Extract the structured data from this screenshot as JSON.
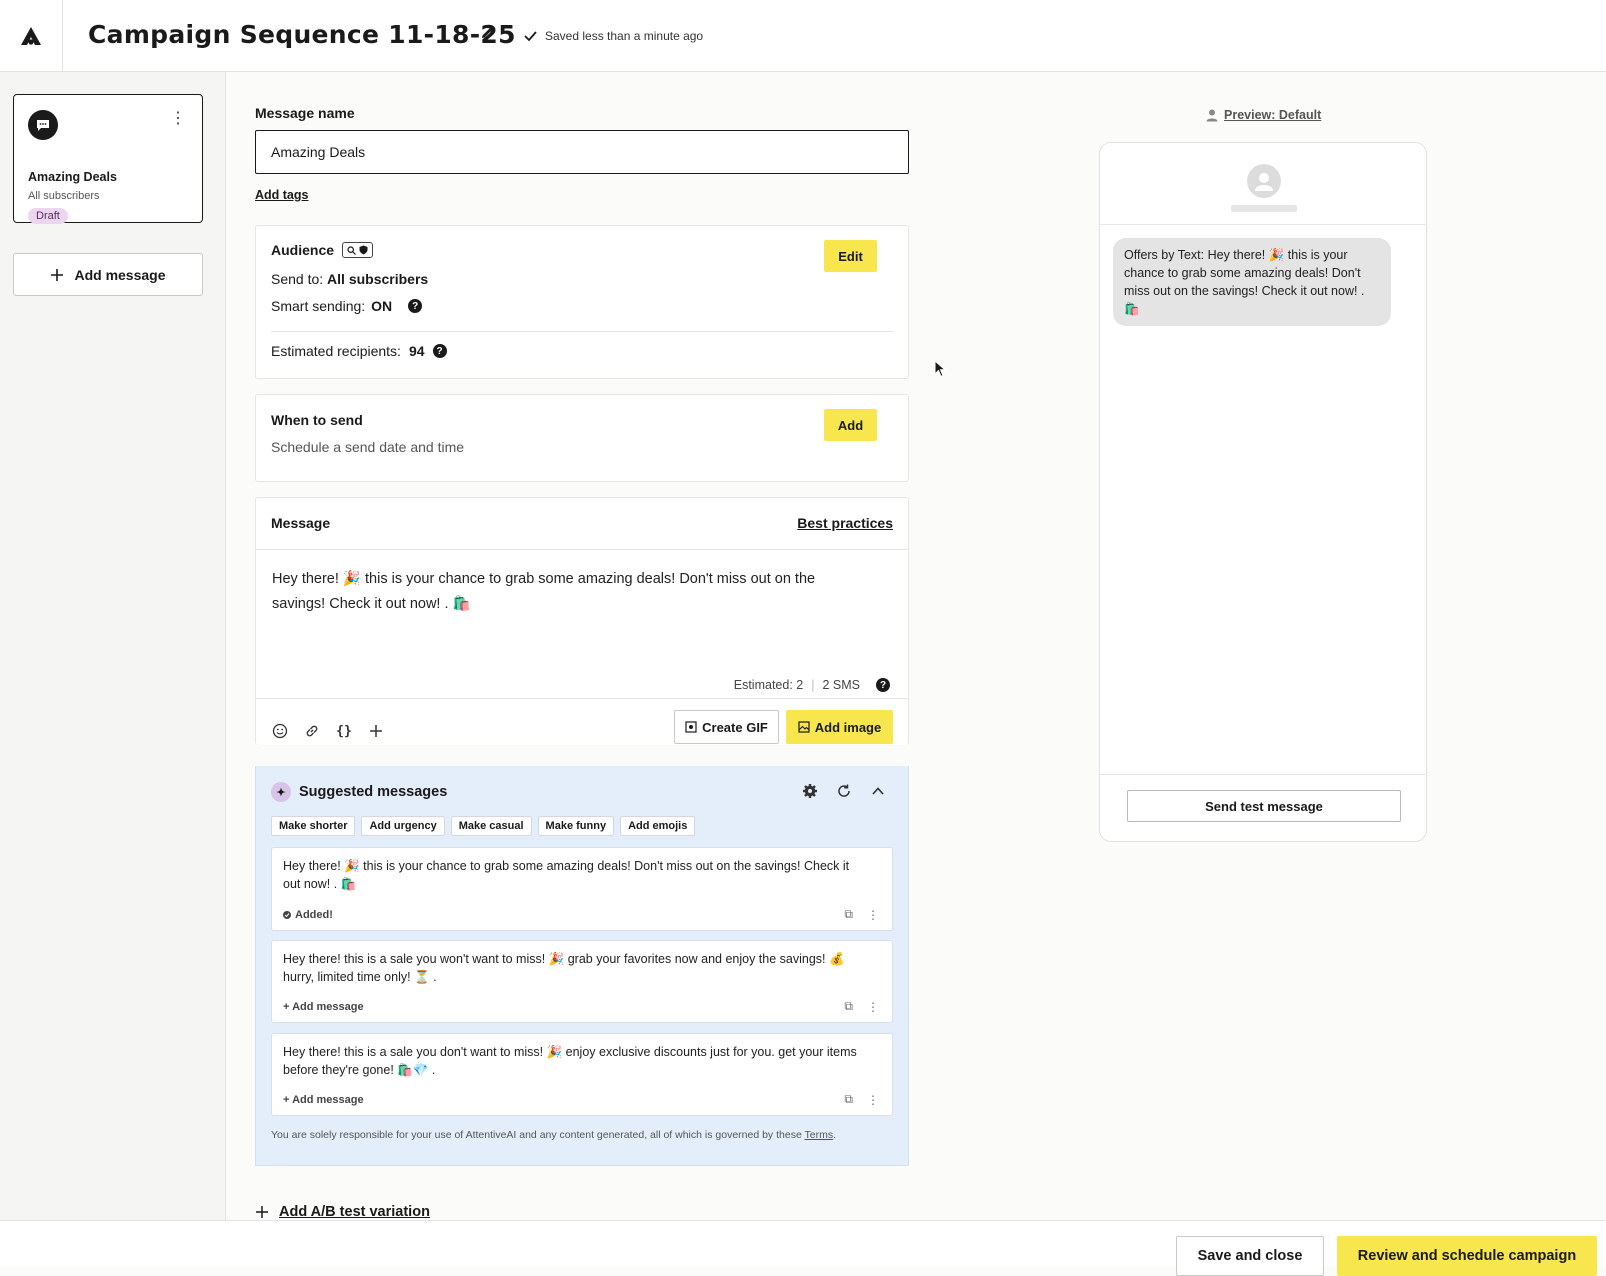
{
  "header": {
    "title": "Campaign Sequence 11-18-25",
    "saved_status": "Saved less than a minute ago"
  },
  "sidebar": {
    "message_card": {
      "name": "Amazing Deals",
      "audience": "All subscribers",
      "status": "Draft"
    },
    "add_message_label": "Add message"
  },
  "editor": {
    "message_name_label": "Message name",
    "message_name_value": "Amazing Deals",
    "add_tags_label": "Add tags",
    "audience": {
      "title": "Audience",
      "edit_label": "Edit",
      "send_to_label": "Send to:",
      "send_to_value": "All subscribers",
      "smart_sending_label": "Smart sending:",
      "smart_sending_value": "ON",
      "estimated_label": "Estimated recipients:",
      "estimated_value": "94"
    },
    "when": {
      "title": "When to send",
      "subtitle": "Schedule a send date and time",
      "add_label": "Add"
    },
    "message": {
      "title": "Message",
      "best_practices_label": "Best practices",
      "body": "Hey there! 🎉 this is your chance to grab some amazing deals! Don't miss out on the savings! Check it out now! . 🛍️",
      "estimated_label": "Estimated: 2",
      "sms_label": "2 SMS",
      "create_gif_label": "Create GIF",
      "add_image_label": "Add image"
    },
    "suggested": {
      "title": "Suggested messages",
      "chips": [
        "Make shorter",
        "Add urgency",
        "Make casual",
        "Make funny",
        "Add emojis"
      ],
      "cards": [
        {
          "text": "Hey there! 🎉 this is your chance to grab some amazing deals! Don't miss out on the savings! Check it out now! . 🛍️",
          "action": "Added!"
        },
        {
          "text": "Hey there! this is a sale you won't want to miss! 🎉 grab your favorites now and enjoy the savings! 💰 hurry, limited time only! ⏳ .",
          "action": "+ Add message"
        },
        {
          "text": "Hey there! this is a sale you don't want to miss! 🎉 enjoy exclusive discounts just for you. get your items before they're gone! 🛍️💎 .",
          "action": "+ Add message"
        }
      ],
      "disclaimer": "You are solely responsible for your use of AttentiveAI and any content generated, all of which is governed by these",
      "terms_label": "Terms"
    },
    "ab_test_label": "Add A/B test variation"
  },
  "preview": {
    "link_label": "Preview: Default",
    "bubble_text": "Offers by Text: Hey there! 🎉 this is your chance to grab some amazing deals! Don't miss out on the savings! Check it out now! . 🛍️",
    "send_test_label": "Send test message"
  },
  "footer": {
    "save_close_label": "Save and close",
    "review_label": "Review and schedule campaign"
  },
  "colors": {
    "accent_yellow": "#f7e64e",
    "suggest_bg": "#e4edfa",
    "draft_badge": "#ecd6ef"
  }
}
